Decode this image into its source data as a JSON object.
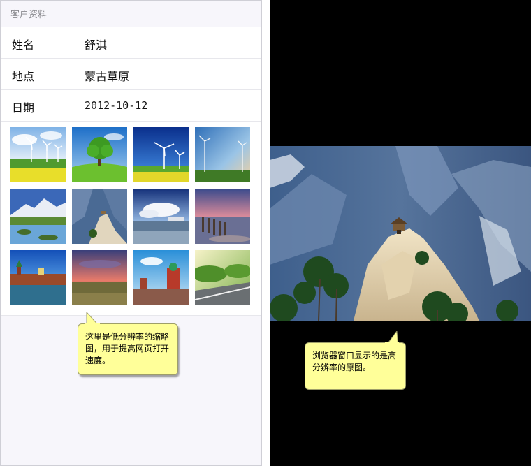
{
  "section": {
    "title": "客户资料"
  },
  "fields": [
    {
      "label": "姓名",
      "value": "舒淇"
    },
    {
      "label": "地点",
      "value": "蒙古草原"
    },
    {
      "label": "日期",
      "value": "2012-10-12"
    }
  ],
  "thumbnails": [
    {
      "icon": "wind-turbines-rapeseed-icon"
    },
    {
      "icon": "tree-on-hill-icon"
    },
    {
      "icon": "wind-turbines-blue-sky-icon"
    },
    {
      "icon": "wind-turbines-sunset-icon"
    },
    {
      "icon": "snow-mountain-lake-icon"
    },
    {
      "icon": "mountain-peak-pavilion-icon"
    },
    {
      "icon": "seaside-clouds-icon"
    },
    {
      "icon": "beach-posts-sunset-icon"
    },
    {
      "icon": "kremlin-river-icon"
    },
    {
      "icon": "field-sunset-icon"
    },
    {
      "icon": "red-square-icon"
    },
    {
      "icon": "road-sunlight-icon"
    }
  ],
  "annotations": {
    "left": "这里是低分辨率的缩略图，用于提高网页打开速度。",
    "right": "浏览器窗口显示的是高分辨率的原图。"
  },
  "colors": {
    "bubble": "#ffff99",
    "viewer_background": "#000000",
    "list_background": "#f7f6fb"
  }
}
